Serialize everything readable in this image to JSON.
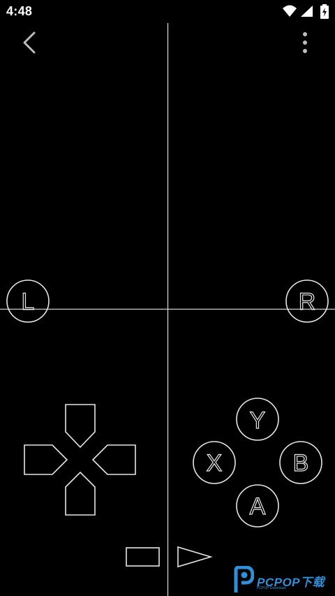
{
  "status_bar": {
    "time": "4:48",
    "icons": [
      "wifi-icon",
      "cellular-signal-icon",
      "battery-charging-icon"
    ]
  },
  "toolbar": {
    "back_icon": "chevron-left-icon",
    "menu_icon": "more-vertical-icon"
  },
  "controller": {
    "shoulder_left": "L",
    "shoulder_right": "R",
    "buttons": {
      "y": "Y",
      "x": "X",
      "b": "B",
      "a": "A"
    },
    "dpad_icon": "dpad-icon",
    "select_icon": "select-button-icon",
    "start_icon": "start-button-icon"
  },
  "colors": {
    "background": "#000000",
    "outline": "#e6e6e6",
    "watermark": "#2f8fd8"
  },
  "watermark": {
    "brand": "PCPOP下载",
    "sub": "PCPOP Download"
  }
}
